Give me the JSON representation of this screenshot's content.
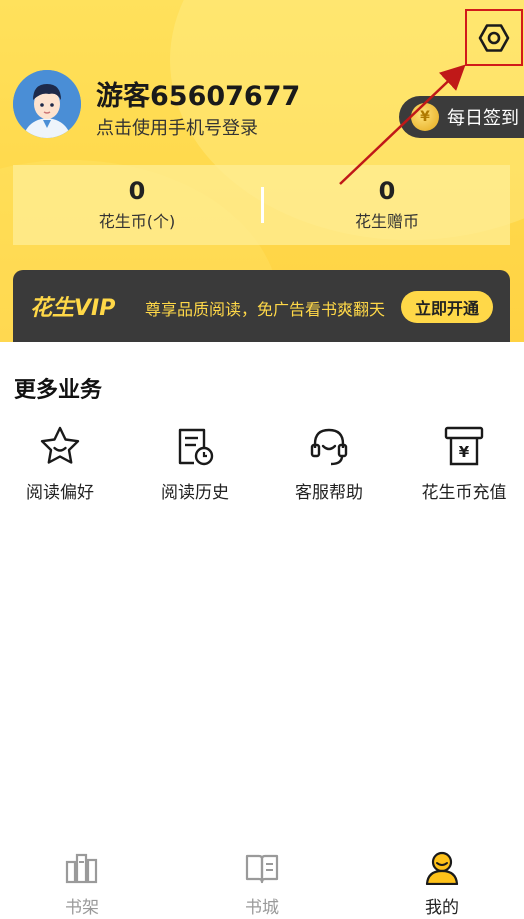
{
  "profile": {
    "username": "游客65607677",
    "login_hint": "点击使用手机号登录",
    "avatar_icon": "user-avatar"
  },
  "header": {
    "settings_icon": "gear-icon",
    "signin_label": "每日签到",
    "signin_coin": "¥"
  },
  "stats": [
    {
      "value": "0",
      "label": "花生币(个)"
    },
    {
      "value": "0",
      "label": "花生赠币"
    }
  ],
  "vip": {
    "brand": "花生VIP",
    "description": "尊享品质阅读，免广告看书爽翻天",
    "button": "立即开通"
  },
  "services": {
    "title": "更多业务",
    "items": [
      {
        "label": "阅读偏好",
        "icon": "star-icon"
      },
      {
        "label": "阅读历史",
        "icon": "history-icon"
      },
      {
        "label": "客服帮助",
        "icon": "headset-icon"
      },
      {
        "label": "花生币充值",
        "icon": "recharge-icon"
      }
    ]
  },
  "tabbar": {
    "items": [
      {
        "label": "书架",
        "icon": "bookshelf-icon",
        "active": false
      },
      {
        "label": "书城",
        "icon": "book-icon",
        "active": false
      },
      {
        "label": "我的",
        "icon": "profile-icon",
        "active": true
      }
    ]
  },
  "colors": {
    "header_yellow": "#ffd84a",
    "vip_gold": "#ffd848",
    "vip_dark": "#3a3a3a",
    "annotation_red": "#d11a1a"
  }
}
